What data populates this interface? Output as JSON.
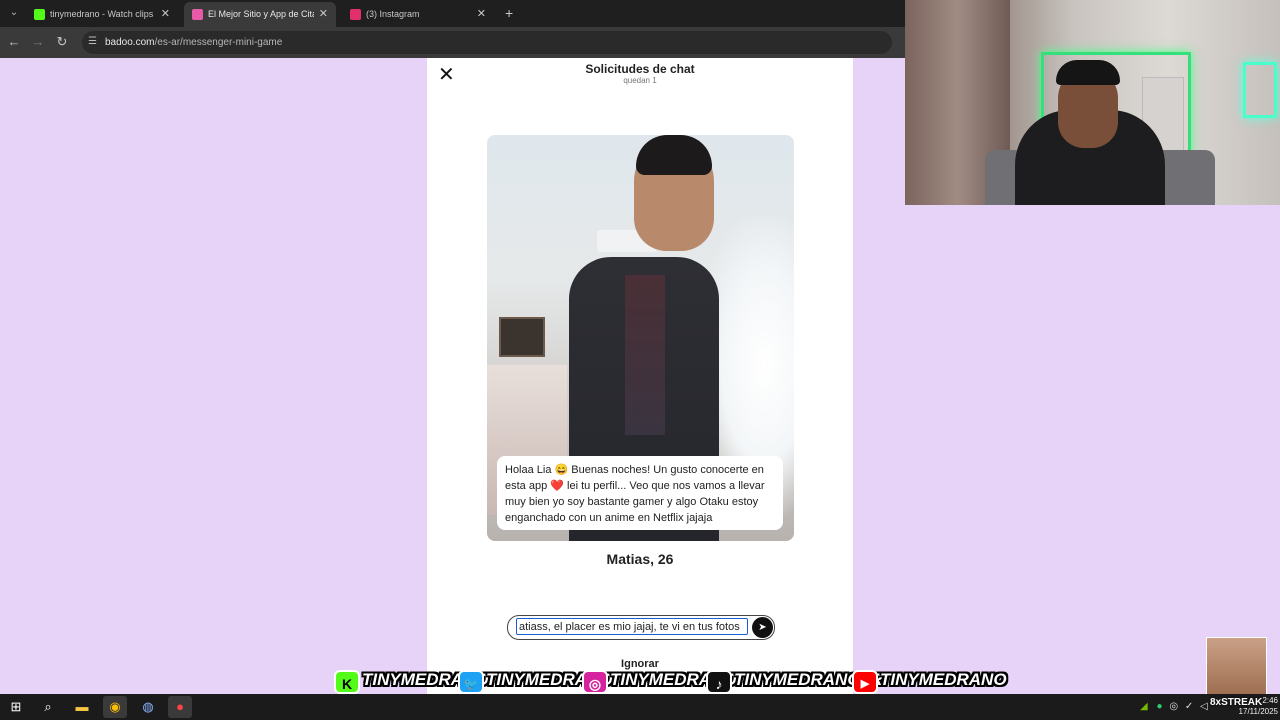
{
  "browser": {
    "tabs": [
      {
        "title": "tinymedrano - Watch clips on Kick",
        "favicon_color": "#53fc18",
        "active": false
      },
      {
        "title": "El Mejor Sitio y App de Citas Gratis",
        "favicon_color": "#e85aa7",
        "active": true
      },
      {
        "title": "(3) Instagram",
        "favicon_color": "#e1306c",
        "active": false
      }
    ],
    "url_host": "badoo.com",
    "url_path": "/es-ar/messenger-mini-game"
  },
  "chat": {
    "title": "Solicitudes de chat",
    "subtitle": "quedan 1",
    "message": "Holaa Lia 😄 Buenas noches! Un gusto conocerte en esta app ❤️ lei tu perfil... Veo que nos vamos a llevar muy bien yo soy bastante gamer y algo Otaku estoy enganchado con un anime en Netflix jajaja",
    "profile_name": "Matias, 26",
    "reply_value": "atiass, el placer es mio jajaj, te vi en tus fotos",
    "ignore_label": "Ignorar"
  },
  "social": [
    {
      "platform": "kick",
      "icon": "K",
      "handle": "TINYMEDRANO",
      "color": "#53fc18"
    },
    {
      "platform": "twitter",
      "icon": "🐦",
      "handle": "TINYMEDRANO",
      "color": "#1da1f2"
    },
    {
      "platform": "instagram",
      "icon": "◎",
      "handle": "TINYMEDRANO",
      "color": "#d6249f"
    },
    {
      "platform": "tiktok",
      "icon": "♪",
      "handle": "TINYMEDRANOJR",
      "color": "#111111"
    },
    {
      "platform": "youtube",
      "icon": "▶",
      "handle": "TINYMEDRANO",
      "color": "#ff0000"
    }
  ],
  "taskbar": {
    "time": "2:46",
    "date": "17/11/2025",
    "streak_label": "8xSTREAK"
  },
  "colors": {
    "page_background": "#e7d3f7",
    "panel": "#ffffff",
    "input_focus": "#1a5fd7"
  }
}
